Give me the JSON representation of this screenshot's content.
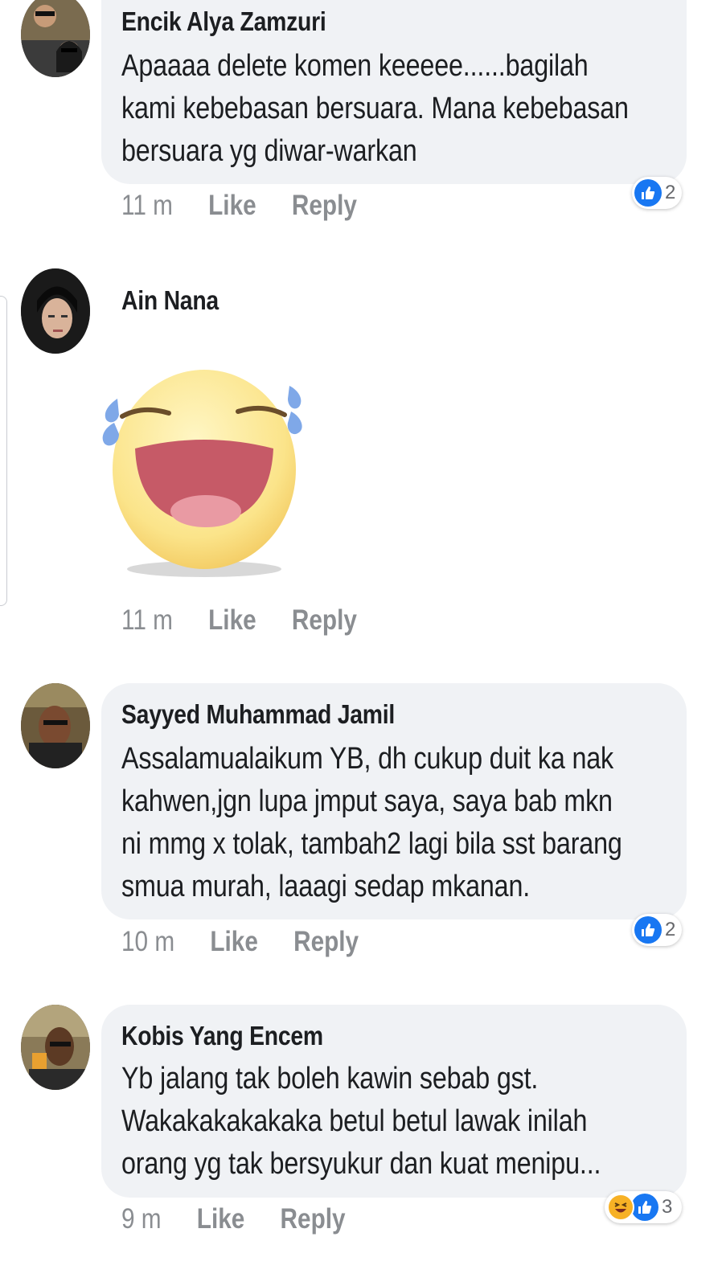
{
  "comments": [
    {
      "author": "Encik Alya Zamzuri",
      "text": "Apaaaa delete komen keeeee......bagilah\nkami kebebasan bersuara. Mana kebebasan\nbersuara yg diwar-warkan",
      "time": "11 m",
      "like_label": "Like",
      "reply_label": "Reply",
      "reaction_count": "2",
      "reactions": [
        "like-icon"
      ]
    },
    {
      "author": "Ain Nana",
      "sticker": "laughing-tears-sticker",
      "time": "11 m",
      "like_label": "Like",
      "reply_label": "Reply"
    },
    {
      "author": "Sayyed Muhammad Jamil",
      "text": "Assalamualaikum YB, dh cukup duit ka nak\nkahwen,jgn lupa jmput saya, saya bab mkn\nni mmg x tolak, tambah2 lagi bila sst barang\nsmua murah, laaagi sedap mkanan.",
      "time": "10 m",
      "like_label": "Like",
      "reply_label": "Reply",
      "reaction_count": "2",
      "reactions": [
        "like-icon"
      ]
    },
    {
      "author": "Kobis Yang Encem",
      "text": "Yb jalang tak boleh kawin sebab gst.\nWakakakakakaka betul betul lawak inilah\norang yg tak bersyukur dan kuat menipu...",
      "time": "9 m",
      "like_label": "Like",
      "reply_label": "Reply",
      "reaction_count": "3",
      "reactions": [
        "haha-icon",
        "like-icon"
      ]
    }
  ],
  "colors": {
    "bubble": "#f0f2f5",
    "meta_text": "#8a8d91",
    "like_blue": "#1877f2",
    "haha_yellow": "#f7b125"
  }
}
